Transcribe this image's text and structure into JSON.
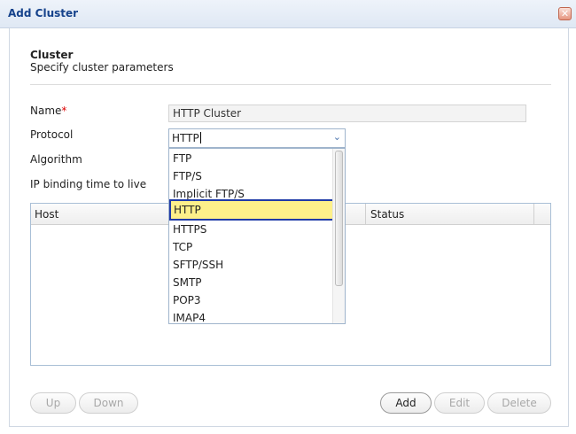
{
  "window": {
    "title": "Add Cluster",
    "close_glyph": "✕"
  },
  "section": {
    "title": "Cluster",
    "subtitle": "Specify cluster parameters"
  },
  "form": {
    "name_label": "Name",
    "required_mark": "*",
    "name_value": "HTTP Cluster",
    "protocol_label": "Protocol",
    "protocol_value": "HTTP",
    "algorithm_label": "Algorithm",
    "ip_binding_label": "IP binding time to live"
  },
  "protocol_dropdown": {
    "options": [
      "FTP",
      "FTP/S",
      "Implicit FTP/S",
      "HTTP",
      "HTTPS",
      "TCP",
      "SFTP/SSH",
      "SMTP",
      "POP3",
      "IMAP4"
    ],
    "selected": "HTTP"
  },
  "hosts_grid": {
    "columns": [
      "Host",
      "Status"
    ]
  },
  "buttons": {
    "up": "Up",
    "down": "Down",
    "add": "Add",
    "edit": "Edit",
    "delete": "Delete"
  },
  "icons": {
    "close": "close-icon",
    "chevron": "chevron-down-icon"
  },
  "colors": {
    "title_text": "#15428b",
    "required": "#dd0000",
    "highlight_fill": "#fdf08a",
    "highlight_border": "#1f3aa8"
  }
}
